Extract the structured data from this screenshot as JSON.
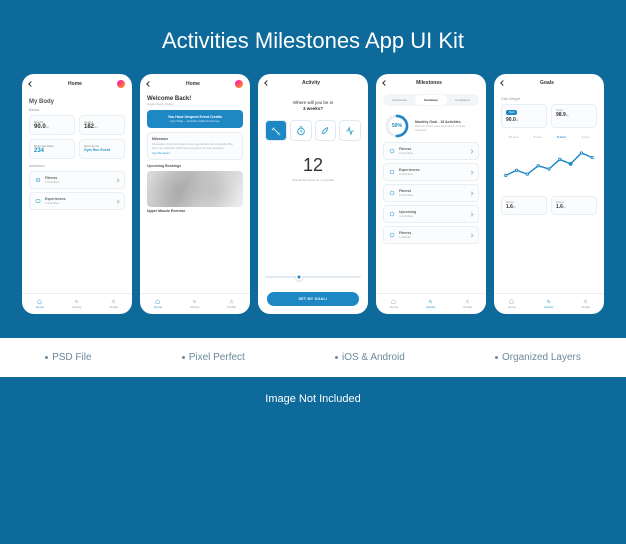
{
  "page_title": "Activities Milestones App UI Kit",
  "footer_note": "Image Not Included",
  "features": [
    "PSD File",
    "Pixel Perfect",
    "iOS & Android",
    "Organized Layers"
  ],
  "nav": {
    "home": "Home",
    "activity": "Activity",
    "profile": "Profile"
  },
  "screen1": {
    "header": "Home",
    "title": "My Body",
    "basics_label": "Basics",
    "advanced_label": "Advanced",
    "weight": {
      "label": "Weight",
      "value": "90.0",
      "unit": "kg"
    },
    "height": {
      "label": "Height",
      "value": "182",
      "unit": "cm"
    },
    "bodyfat": {
      "label": "Body Fat Ratio",
      "value": "234"
    },
    "experience": {
      "label": "Experience",
      "value": "Gym Run Event"
    },
    "fitness": {
      "title": "Fitness",
      "sub": "3 Activities"
    },
    "experiences": {
      "title": "Experiences",
      "sub": "3 Activities"
    }
  },
  "screen2": {
    "header": "Home",
    "greet": "Welcome Back!",
    "greet_sub": "Happy Event Today!",
    "banner_title": "You Have Unspent Event Credits",
    "banner_sub": "Gym Today — schedule credits for new here",
    "milestone_title": "Milestone",
    "milestone_desc": "Consectetur minim lorem ipsum sit eu, ag totemdos. Nec eu laborist Milet lorem nec. Olanredi t minim lorem rep ipsum od mode tecosedos.",
    "milestone_event": "Gym Run Event",
    "upcoming_label": "Upcoming Bookings",
    "booking_title": "Upper Muscle Exercise"
  },
  "screen3": {
    "header": "Activity",
    "question_line1": "Where will you be in",
    "question_line2": "3 weeks?",
    "big_number": "12",
    "big_sub": "Special Moments for my Health",
    "cta": "SET MY GOAL!"
  },
  "screen4": {
    "header": "Milestones",
    "tabs": {
      "successes": "Successes",
      "summary": "Summary",
      "completed": "Completed"
    },
    "goal_title": "Monthly Goal - 18 Activities",
    "goal_desc": "Olanredi t minim lorem ipsum ipsum od mode tecosedos.",
    "percent": "50%",
    "items": [
      {
        "cat": "Fitness",
        "sub": "3 Activities"
      },
      {
        "cat": "Experiences",
        "sub": "3 Activities"
      },
      {
        "cat": "Fitness",
        "sub": "2 Activities"
      },
      {
        "cat": "Upcoming",
        "sub": "3 Activities"
      },
      {
        "cat": "Fitness",
        "sub": "1 Activity"
      }
    ]
  },
  "screen5": {
    "header": "Goals",
    "subtitle": "Gain Weight",
    "start": {
      "label": "Start",
      "value": "90.0",
      "unit": "kg"
    },
    "target": {
      "label": "Target",
      "value": "98.9",
      "unit": "kg"
    },
    "time_tabs": [
      "10 mon",
      "8 mon",
      "6 mon",
      "4 mon"
    ],
    "active_time": "6 mon",
    "bottom_stats": [
      {
        "label": "Fitness",
        "value": "1.6",
        "unit": "kg"
      },
      {
        "label": "Fitness",
        "value": "1.6",
        "unit": "kg"
      }
    ]
  },
  "chart_data": {
    "type": "line",
    "title": "Gain Weight",
    "x": [
      0,
      1,
      2,
      3,
      4,
      5,
      6,
      7,
      8
    ],
    "values": [
      20,
      28,
      22,
      35,
      30,
      45,
      38,
      55,
      48
    ],
    "ylim": [
      0,
      60
    ],
    "xlabel": "",
    "ylabel": ""
  }
}
